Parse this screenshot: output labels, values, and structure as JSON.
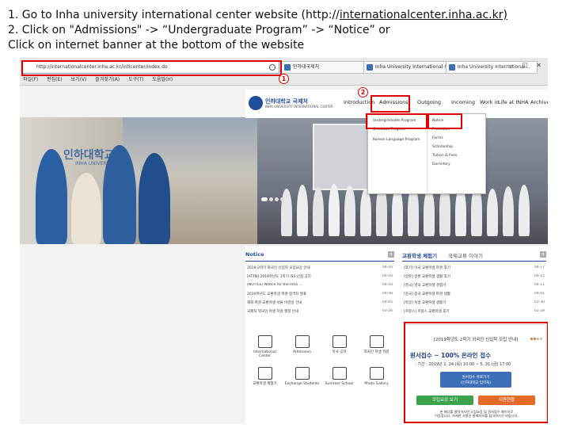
{
  "instructions": {
    "line1_prefix": "1. Go to Inha university international center website (http://",
    "line1_link": "internationalcenter.inha.ac.kr)",
    "line2": "2. Click on \"Admissions\" -> “Undergraduate Program” -> “Notice” or",
    "line3": "Click on internet banner at the bottom of the website"
  },
  "browser": {
    "url": "http://internationalcenter.inha.ac.kr/intlcenter/index.do",
    "tabs": [
      "인하대국제처",
      "Inha University International C...",
      "Inha University International..."
    ],
    "menu": [
      "파일(F)",
      "편집(E)",
      "보기(V)",
      "즐겨찾기(A)",
      "도구(T)",
      "도움말(H)"
    ],
    "window_controls": "— ☐ ✕"
  },
  "site": {
    "logo_name": "인하대학교 국제처",
    "logo_sub": "INHA UNIVERSITY INTERNATIONAL CENTER",
    "nav": [
      "Introduction",
      "Admissions",
      "Outgoing",
      "Incoming",
      "Work in",
      "Life at INHA",
      "Archive"
    ],
    "dropdown_left": [
      "Undergraduate Program",
      "Graduate Program",
      "Korean Language Program"
    ],
    "dropdown_right": [
      "Notice",
      "Procedure",
      "Forms",
      "Scholarship",
      "Tuition & Fees",
      "Dormitory"
    ],
    "hero_caption_kr": "인하대학교",
    "hero_caption_en": "INHA UNIVERSITY"
  },
  "notice": {
    "title": "Notice",
    "rows": [
      {
        "text": "2019-2학기 외국인 신입학 모집요강 안내",
        "date": "04-16"
      },
      {
        "text": "[ATTN] 2019학년도 1학기 ISS 신청 공지",
        "date": "04-10"
      },
      {
        "text": "[NOTICE] Notice for the Inha ...",
        "date": "04-10"
      },
      {
        "text": "2019학년도 교환학생 파견 합격자 발표",
        "date": "04-08"
      },
      {
        "text": "해외 파견 교환학생 서류 마감일 안내",
        "date": "04-05"
      },
      {
        "text": "국제처 외국인 학생 지원 행정 안내",
        "date": "03-26"
      }
    ]
  },
  "stories": {
    "title": "교환학생 체험기",
    "title2": "국제교류 이야기",
    "rows": [
      {
        "text": "[후기] 미국 교환학생 파견 후기",
        "date": "04-17"
      },
      {
        "text": "[일본] 일본 교환학생 생활 후기",
        "date": "04-15"
      },
      {
        "text": "[영국] 영국 교환학생 경험기",
        "date": "04-11"
      },
      {
        "text": "[중국] 중국 교환학생 파견 생활",
        "date": "04-01"
      },
      {
        "text": "[독일] 독일 교환학생 생활기",
        "date": "01-30"
      },
      {
        "text": "[프랑스] 프랑스 교환학생 후기",
        "date": "01-29"
      }
    ]
  },
  "quick_links": [
    {
      "icon": "globe-icon",
      "label": "International Center"
    },
    {
      "icon": "monitor-icon",
      "label": "Admission"
    },
    {
      "icon": "book-icon",
      "label": "학사 공지"
    },
    {
      "icon": "graduation-cap-icon",
      "label": "외국인 학생 지원"
    },
    {
      "icon": "people-icon",
      "label": "교환학생 체험기"
    },
    {
      "icon": "exchange-icon",
      "label": "Exchange Students"
    },
    {
      "icon": "open-book-icon",
      "label": "Summer School"
    },
    {
      "icon": "photo-icon",
      "label": "Photo Gallery"
    }
  ],
  "banner": {
    "title": "[2019학년도 2학기 외국인 신입학 모집 안내]",
    "headline": "원서접수 ~ 100% 온라인 접수",
    "period": "- 기간 : 2019년 1. 24.(목) 10:00 ~ 5. 31.(금) 17:00",
    "apply_line1": "원서접수 바로가기",
    "apply_line2": "(인하대학교 입학처)",
    "btn_green": "모집요강 보기",
    "btn_blue": "지원현황",
    "note_line1": "본 배너를 클릭하시면 모집요강 및 원서접수 페이지로",
    "note_line2": "이동합니다. 자세한 사항은 홈페이지를 참고하시기 바랍니다."
  },
  "annotations": {
    "marker1": "1",
    "marker2": "2"
  },
  "colors": {
    "annotation": "#e00000",
    "brand_blue": "#1f4e9a",
    "banner_green": "#3aa24a",
    "banner_orange": "#e36b2a"
  }
}
